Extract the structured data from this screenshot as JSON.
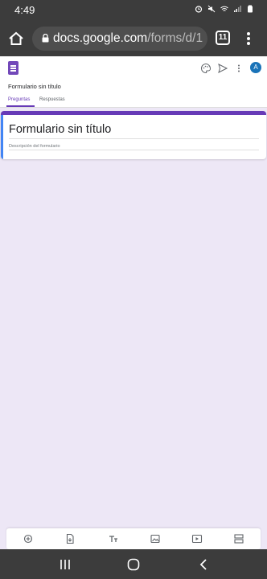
{
  "status_bar": {
    "time": "4:49",
    "icons": [
      "alarm-icon",
      "mute-icon",
      "wifi-icon",
      "signal-icon",
      "battery-icon"
    ]
  },
  "browser": {
    "url_domain": "docs.google.com",
    "url_path": "/forms/d/1",
    "tab_count": "11"
  },
  "forms_header": {
    "doc_title": "Formulario sin título",
    "icons": [
      "palette-icon",
      "send-icon",
      "more-vert-icon"
    ],
    "avatar_letter": "A",
    "tabs": [
      {
        "label": "Preguntas",
        "active": true
      },
      {
        "label": "Respuestas",
        "active": false
      }
    ]
  },
  "form_card": {
    "title": "Formulario sin título",
    "description_placeholder": "Descripción del formulario"
  },
  "toolbar": {
    "buttons": [
      "add-question-icon",
      "import-questions-icon",
      "add-title-icon",
      "add-image-icon",
      "add-video-icon",
      "add-section-icon"
    ]
  },
  "colors": {
    "accent": "#673ab7",
    "background": "#ede7f6",
    "left_bar": "#4285f4"
  }
}
